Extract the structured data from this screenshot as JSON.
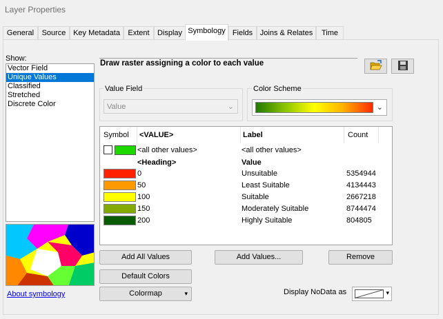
{
  "window": {
    "title": "Layer Properties"
  },
  "tabs": [
    {
      "label": "General"
    },
    {
      "label": "Source"
    },
    {
      "label": "Key Metadata"
    },
    {
      "label": "Extent"
    },
    {
      "label": "Display"
    },
    {
      "label": "Symbology",
      "active": true
    },
    {
      "label": "Fields"
    },
    {
      "label": "Joins & Relates"
    },
    {
      "label": "Time"
    }
  ],
  "show": {
    "label": "Show:",
    "items": [
      "Vector Field",
      "Unique Values",
      "Classified",
      "Stretched",
      "Discrete Color"
    ],
    "selected": "Unique Values"
  },
  "description": "Draw raster assigning a color to each value",
  "icons": {
    "open": "folder-open-icon",
    "save": "save-disk-icon"
  },
  "value_field": {
    "label": "Value Field",
    "value": "Value"
  },
  "color_scheme": {
    "label": "Color Scheme",
    "colors": [
      "#1f7a00",
      "#8cc400",
      "#ffff00",
      "#ffb000",
      "#ff2a00"
    ]
  },
  "table": {
    "headers": {
      "symbol": "Symbol",
      "value": "<VALUE>",
      "label": "Label",
      "count": "Count"
    },
    "other": {
      "value": "<all other values>",
      "label": "<all other values>",
      "color": "#1ed900"
    },
    "heading": {
      "value": "<Heading>",
      "label": "Value"
    },
    "rows": [
      {
        "color": "#ff2200",
        "value": "0",
        "label": "Unsuitable",
        "count": "5354944"
      },
      {
        "color": "#ff9900",
        "value": "50",
        "label": "Least Suitable",
        "count": "4134443"
      },
      {
        "color": "#ffff00",
        "value": "100",
        "label": "Suitable",
        "count": "2667218"
      },
      {
        "color": "#84aa00",
        "value": "150",
        "label": "Moderately Suitable",
        "count": "8744474"
      },
      {
        "color": "#0a5c00",
        "value": "200",
        "label": "Highly Suitable",
        "count": "804805"
      }
    ]
  },
  "buttons": {
    "add_all": "Add All Values",
    "add_values": "Add Values...",
    "remove": "Remove",
    "default_colors": "Default Colors",
    "colormap": "Colormap"
  },
  "about_link": "About symbology",
  "nodata": {
    "label": "Display NoData as"
  }
}
